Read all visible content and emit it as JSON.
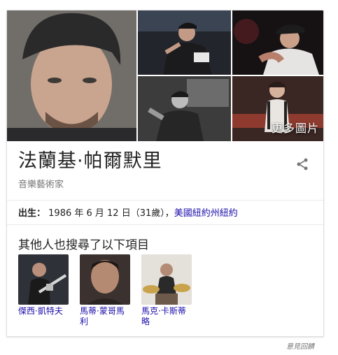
{
  "images": {
    "more_photos_label": "更多圖片"
  },
  "entity": {
    "title": "法蘭基·帕爾默里",
    "subtitle": "音樂藝術家"
  },
  "born": {
    "label": "出生：",
    "date": "1986 年 6 月 12 日（31歲）",
    "separator": "，",
    "place": "美國紐約州紐約"
  },
  "people_also_search": {
    "heading": "其他人也搜尋了以下項目",
    "items": [
      {
        "name": "傑西·凱特夫"
      },
      {
        "name": "馬蒂·蒙哥馬利"
      },
      {
        "name": "馬克·卡斯蒂略"
      }
    ]
  },
  "feedback_label": "意見回饋",
  "colors": {
    "link": "#1a0dab",
    "title": "#222222",
    "muted": "#777777"
  },
  "icons": {
    "share": "share-icon"
  }
}
